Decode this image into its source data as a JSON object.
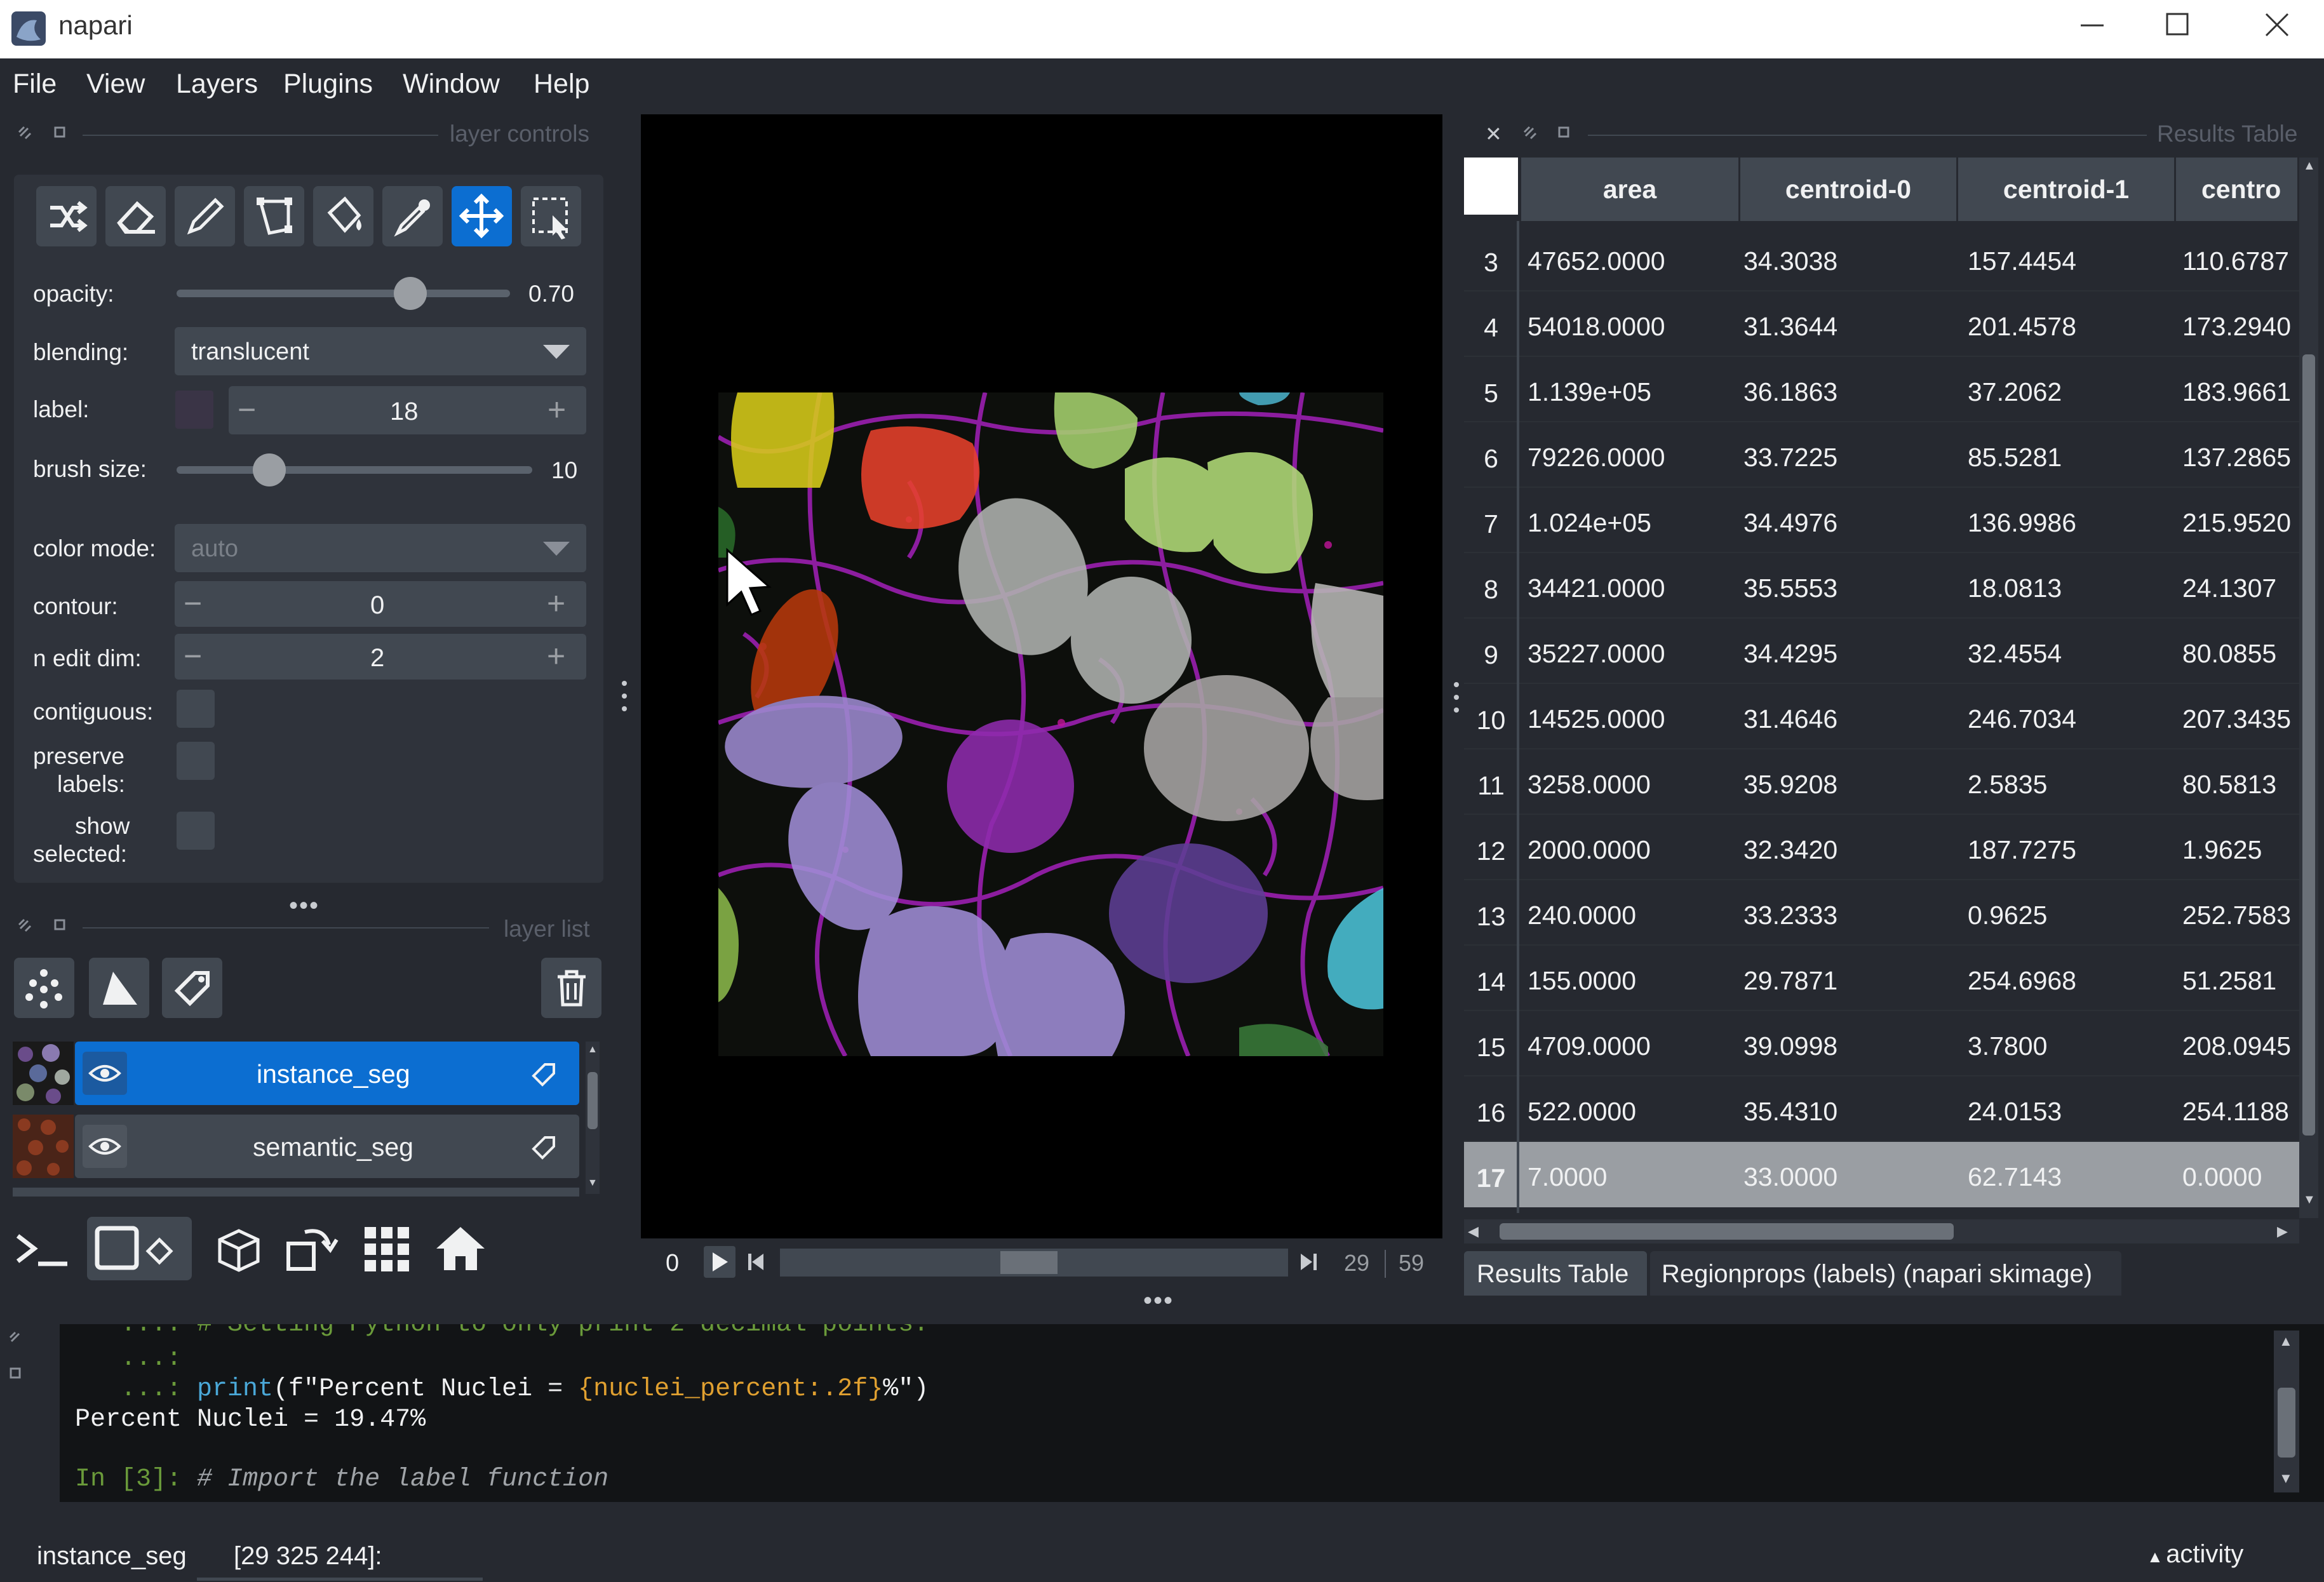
{
  "window": {
    "title": "napari",
    "minimize": "—",
    "maximize": "☐",
    "close": "✕"
  },
  "menu": [
    "File",
    "View",
    "Layers",
    "Plugins",
    "Window",
    "Help"
  ],
  "layer_controls": {
    "title": "layer controls",
    "opacity_label": "opacity:",
    "opacity_value": "0.70",
    "opacity_fraction": 0.7,
    "blending_label": "blending:",
    "blending_value": "translucent",
    "label_label": "label:",
    "label_value": "18",
    "brush_label": "brush size:",
    "brush_value": "10",
    "brush_fraction": 0.26,
    "color_mode_label": "color mode:",
    "color_mode_value": "auto",
    "contour_label": "contour:",
    "contour_value": "0",
    "n_edit_dim_label": "n edit dim:",
    "n_edit_dim_value": "2",
    "contiguous_label": "contiguous:",
    "preserve_label_1": "preserve",
    "preserve_label_2": "labels:",
    "show_label_1": "show",
    "show_label_2": "selected:"
  },
  "layer_list": {
    "title": "layer list",
    "layers": [
      {
        "name": "instance_seg",
        "selected": true
      },
      {
        "name": "semantic_seg",
        "selected": false
      }
    ]
  },
  "dims": {
    "left_value": "0",
    "current": "29",
    "max": "59",
    "slider_fraction": 0.49
  },
  "results": {
    "title": "Results Table",
    "columns": [
      "area",
      "centroid-0",
      "centroid-1",
      "centro"
    ],
    "rows": [
      {
        "n": "3",
        "cells": [
          "47652.0000",
          "34.3038",
          "157.4454",
          "110.6787"
        ]
      },
      {
        "n": "4",
        "cells": [
          "54018.0000",
          "31.3644",
          "201.4578",
          "173.2940"
        ]
      },
      {
        "n": "5",
        "cells": [
          "1.139e+05",
          "36.1863",
          "37.2062",
          "183.9661"
        ]
      },
      {
        "n": "6",
        "cells": [
          "79226.0000",
          "33.7225",
          "85.5281",
          "137.2865"
        ]
      },
      {
        "n": "7",
        "cells": [
          "1.024e+05",
          "34.4976",
          "136.9986",
          "215.9520"
        ]
      },
      {
        "n": "8",
        "cells": [
          "34421.0000",
          "35.5553",
          "18.0813",
          "24.1307"
        ]
      },
      {
        "n": "9",
        "cells": [
          "35227.0000",
          "34.4295",
          "32.4554",
          "80.0855"
        ]
      },
      {
        "n": "10",
        "cells": [
          "14525.0000",
          "31.4646",
          "246.7034",
          "207.3435"
        ]
      },
      {
        "n": "11",
        "cells": [
          "3258.0000",
          "35.9208",
          "2.5835",
          "80.5813"
        ]
      },
      {
        "n": "12",
        "cells": [
          "2000.0000",
          "32.3420",
          "187.7275",
          "1.9625"
        ]
      },
      {
        "n": "13",
        "cells": [
          "240.0000",
          "33.2333",
          "0.9625",
          "252.7583"
        ]
      },
      {
        "n": "14",
        "cells": [
          "155.0000",
          "29.7871",
          "254.6968",
          "51.2581"
        ]
      },
      {
        "n": "15",
        "cells": [
          "4709.0000",
          "39.0998",
          "3.7800",
          "208.0945"
        ]
      },
      {
        "n": "16",
        "cells": [
          "522.0000",
          "35.4310",
          "24.0153",
          "254.1188"
        ]
      },
      {
        "n": "17",
        "cells": [
          "7.0000",
          "33.0000",
          "62.7143",
          "0.0000"
        ],
        "selected": true
      }
    ],
    "tabs": [
      "Results Table",
      "Regionprops (labels) (napari skimage)"
    ]
  },
  "console": {
    "line0": "   ...: # Setting Python to only print 2 decimal points.",
    "line1_prompt": "   ...:",
    "line2_prompt": "   ...: ",
    "line2_func": "print",
    "line2_str1": "(f\"Percent Nuclei = ",
    "line2_brace": "{nuclei_percent:.2f}",
    "line2_str2": "%\")",
    "line3": "Percent Nuclei = 19.47%",
    "line4_prompt": "In [3]: ",
    "line4_comment": "# Import the label function"
  },
  "status": {
    "layer": "instance_seg",
    "coords": "[29 325 244]:",
    "activity": "activity"
  },
  "colors": {
    "accent": "#0c6ed1",
    "panel": "#262930",
    "widget": "#414851",
    "selected_row": "#9a9ea3"
  }
}
